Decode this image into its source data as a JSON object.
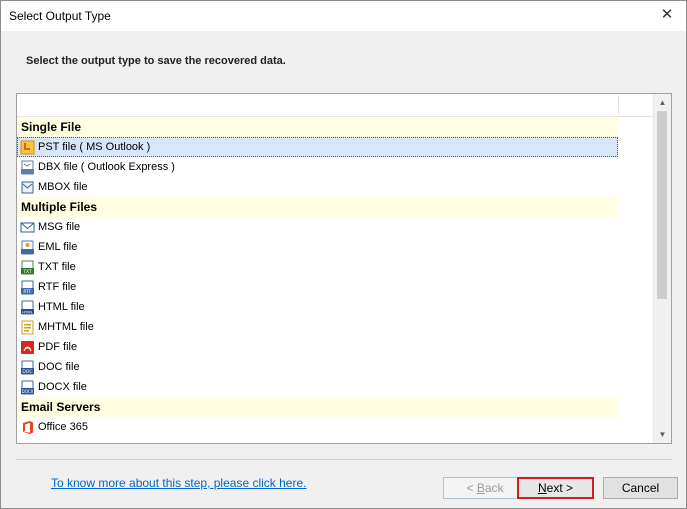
{
  "window": {
    "title": "Select Output Type",
    "close_glyph": "✕"
  },
  "instruction": "Select the output type to save the recovered data.",
  "list": {
    "rows": [
      {
        "kind": "group",
        "label": "Single File"
      },
      {
        "kind": "item",
        "label": "PST file ( MS Outlook )",
        "icon": "pst-file-icon",
        "selected": true
      },
      {
        "kind": "item",
        "label": "DBX file ( Outlook Express )",
        "icon": "dbx-file-icon"
      },
      {
        "kind": "item",
        "label": "MBOX file",
        "icon": "mbox-file-icon"
      },
      {
        "kind": "group",
        "label": "Multiple Files"
      },
      {
        "kind": "item",
        "label": "MSG file",
        "icon": "msg-file-icon"
      },
      {
        "kind": "item",
        "label": "EML file",
        "icon": "eml-file-icon"
      },
      {
        "kind": "item",
        "label": "TXT file",
        "icon": "txt-file-icon"
      },
      {
        "kind": "item",
        "label": "RTF file",
        "icon": "rtf-file-icon"
      },
      {
        "kind": "item",
        "label": "HTML file",
        "icon": "html-file-icon"
      },
      {
        "kind": "item",
        "label": "MHTML file",
        "icon": "mhtml-file-icon"
      },
      {
        "kind": "item",
        "label": "PDF file",
        "icon": "pdf-file-icon"
      },
      {
        "kind": "item",
        "label": "DOC file",
        "icon": "doc-file-icon"
      },
      {
        "kind": "item",
        "label": "DOCX file",
        "icon": "docx-file-icon"
      },
      {
        "kind": "group",
        "label": "Email Servers"
      },
      {
        "kind": "item",
        "label": "Office 365",
        "icon": "office365-icon"
      }
    ]
  },
  "footer": {
    "help_link": "To know more about this step, please click here.",
    "back": {
      "prefix": "< ",
      "accel": "B",
      "rest": "ack"
    },
    "next": {
      "accel": "N",
      "rest": "ext >"
    },
    "cancel": "Cancel"
  },
  "colors": {
    "group_bg": "#fffee0",
    "selected_bg": "#d9e6f7",
    "link": "#0066cc",
    "next_border": "#d02020"
  }
}
